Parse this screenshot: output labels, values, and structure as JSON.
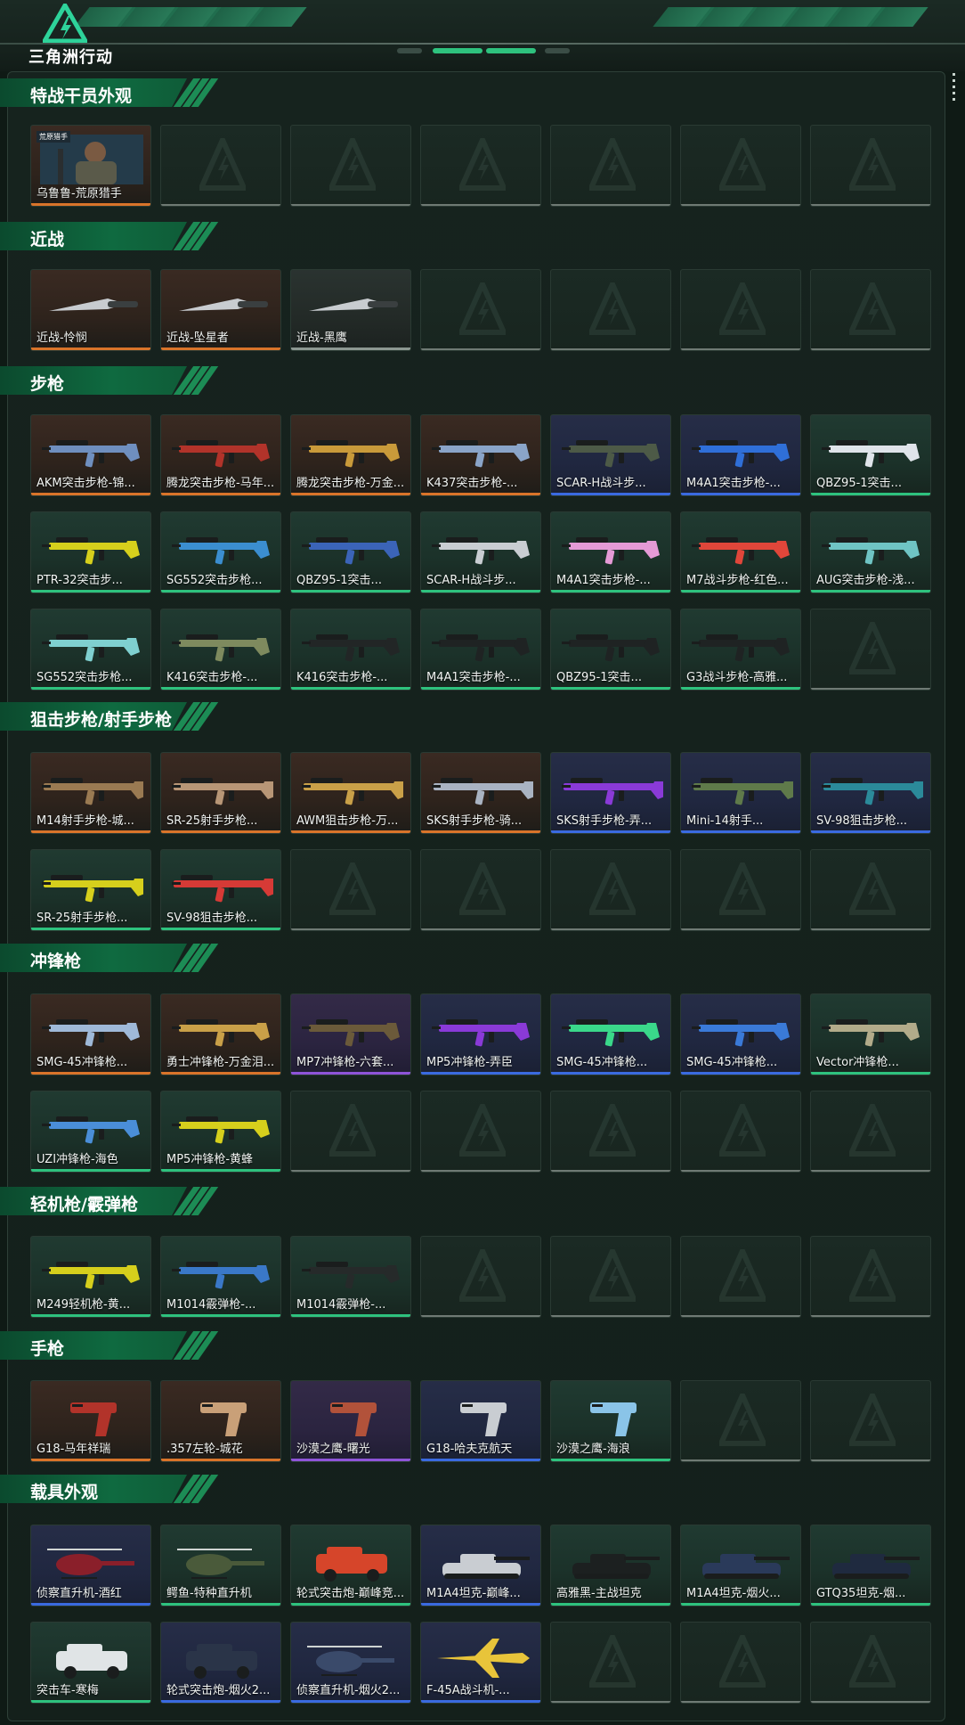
{
  "app": {
    "logo_text": "三角洲行动"
  },
  "colors": {
    "accent": "#2ec27e",
    "rarity_orange": "#d9742a",
    "rarity_blue": "#3a6ae0",
    "rarity_green": "#2ec27e",
    "rarity_purple": "#8e54d8",
    "rarity_gray": "#8c9791"
  },
  "sections": [
    {
      "title": "特战干员外观",
      "rows": [
        [
          {
            "name": "乌鲁鲁-荒原猎手",
            "rarity": "orange",
            "icon": "operator-portrait",
            "badge": "荒原猎手"
          },
          null,
          null,
          null,
          null,
          null,
          null
        ]
      ]
    },
    {
      "title": "近战",
      "rows": [
        [
          {
            "name": "近战-怜悯",
            "rarity": "orange",
            "icon": "knife"
          },
          {
            "name": "近战-坠星者",
            "rarity": "orange",
            "icon": "knife"
          },
          {
            "name": "近战-黑鹰",
            "rarity": "gray",
            "icon": "knife"
          },
          null,
          null,
          null,
          null
        ]
      ]
    },
    {
      "title": "步枪",
      "rows": [
        [
          {
            "name": "AKM突击步枪-锦...",
            "rarity": "orange",
            "icon": "rifle",
            "tint": "#6f8fbf"
          },
          {
            "name": "腾龙突击步枪-马年...",
            "rarity": "orange",
            "icon": "rifle",
            "tint": "#b2332a"
          },
          {
            "name": "腾龙突击步枪-万金...",
            "rarity": "orange",
            "icon": "rifle",
            "tint": "#c99a3a"
          },
          {
            "name": "K437突击步枪-...",
            "rarity": "orange",
            "icon": "rifle",
            "tint": "#8aa4c8"
          },
          {
            "name": "SCAR-H战斗步...",
            "rarity": "blue",
            "icon": "rifle",
            "tint": "#4d5a47"
          },
          {
            "name": "M4A1突击步枪-...",
            "rarity": "blue",
            "icon": "rifle",
            "tint": "#2f6fd8"
          },
          {
            "name": "QBZ95-1突击...",
            "rarity": "green",
            "icon": "rifle",
            "tint": "#dfe4ea"
          }
        ],
        [
          {
            "name": "PTR-32突击步...",
            "rarity": "green",
            "icon": "rifle",
            "tint": "#d6cf1c"
          },
          {
            "name": "SG552突击步枪...",
            "rarity": "green",
            "icon": "rifle",
            "tint": "#3b8ed0"
          },
          {
            "name": "QBZ95-1突击...",
            "rarity": "green",
            "icon": "rifle",
            "tint": "#3b64b8"
          },
          {
            "name": "SCAR-H战斗步...",
            "rarity": "green",
            "icon": "rifle",
            "tint": "#c9cdd2"
          },
          {
            "name": "M4A1突击步枪-...",
            "rarity": "green",
            "icon": "rifle",
            "tint": "#e59ad6"
          },
          {
            "name": "M7战斗步枪-红色...",
            "rarity": "green",
            "icon": "rifle",
            "tint": "#e0463a"
          },
          {
            "name": "AUG突击步枪-浅...",
            "rarity": "green",
            "icon": "rifle",
            "tint": "#6fc4c4"
          }
        ],
        [
          {
            "name": "SG552突击步枪...",
            "rarity": "green",
            "icon": "rifle",
            "tint": "#7fd0d0"
          },
          {
            "name": "K416突击步枪-...",
            "rarity": "green",
            "icon": "rifle",
            "tint": "#7e8a5e"
          },
          {
            "name": "K416突击步枪-...",
            "rarity": "green",
            "icon": "rifle",
            "tint": "#222626"
          },
          {
            "name": "M4A1突击步枪-...",
            "rarity": "green",
            "icon": "rifle",
            "tint": "#1f2323"
          },
          {
            "name": "QBZ95-1突击...",
            "rarity": "green",
            "icon": "rifle",
            "tint": "#1f2323"
          },
          {
            "name": "G3战斗步枪-高雅...",
            "rarity": "green",
            "icon": "rifle",
            "tint": "#1f2323"
          },
          null
        ]
      ]
    },
    {
      "title": "狙击步枪/射手步枪",
      "rows": [
        [
          {
            "name": "M14射手步枪-城...",
            "rarity": "orange",
            "icon": "sniper",
            "tint": "#9a7a52"
          },
          {
            "name": "SR-25射手步枪...",
            "rarity": "orange",
            "icon": "sniper",
            "tint": "#b89676"
          },
          {
            "name": "AWM狙击步枪-万...",
            "rarity": "orange",
            "icon": "sniper",
            "tint": "#c9a048"
          },
          {
            "name": "SKS射手步枪-骑...",
            "rarity": "orange",
            "icon": "sniper",
            "tint": "#a9b3c2"
          },
          {
            "name": "SKS射手步枪-弄...",
            "rarity": "blue",
            "icon": "sniper",
            "tint": "#8a3ad8"
          },
          {
            "name": "Mini-14射手...",
            "rarity": "blue",
            "icon": "sniper",
            "tint": "#5f7a4a"
          },
          {
            "name": "SV-98狙击步枪...",
            "rarity": "blue",
            "icon": "sniper",
            "tint": "#2b8a9a"
          }
        ],
        [
          {
            "name": "SR-25射手步枪...",
            "rarity": "green",
            "icon": "sniper",
            "tint": "#d6cf1c"
          },
          {
            "name": "SV-98狙击步枪...",
            "rarity": "green",
            "icon": "sniper",
            "tint": "#d63a36"
          },
          null,
          null,
          null,
          null,
          null
        ]
      ]
    },
    {
      "title": "冲锋枪",
      "rows": [
        [
          {
            "name": "SMG-45冲锋枪...",
            "rarity": "orange",
            "icon": "smg",
            "tint": "#9fb9d8"
          },
          {
            "name": "勇士冲锋枪-万金泪...",
            "rarity": "orange",
            "icon": "smg",
            "tint": "#c9a048"
          },
          {
            "name": "MP7冲锋枪-六套...",
            "rarity": "purple",
            "icon": "smg",
            "tint": "#6b5a3a"
          },
          {
            "name": "MP5冲锋枪-弄臣",
            "rarity": "blue",
            "icon": "smg",
            "tint": "#8a3ad8"
          },
          {
            "name": "SMG-45冲锋枪...",
            "rarity": "blue",
            "icon": "smg",
            "tint": "#3ad88a"
          },
          {
            "name": "SMG-45冲锋枪...",
            "rarity": "blue",
            "icon": "smg",
            "tint": "#3a7ad8"
          },
          {
            "name": "Vector冲锋枪...",
            "rarity": "green",
            "icon": "smg",
            "tint": "#b2ab8a"
          }
        ],
        [
          {
            "name": "UZI冲锋枪-海色",
            "rarity": "green",
            "icon": "smg",
            "tint": "#4a8ed8"
          },
          {
            "name": "MP5冲锋枪-黄蜂",
            "rarity": "green",
            "icon": "smg",
            "tint": "#d6cf1c"
          },
          null,
          null,
          null,
          null,
          null
        ]
      ]
    },
    {
      "title": "轻机枪/霰弹枪",
      "rows": [
        [
          {
            "name": "M249轻机枪-黄...",
            "rarity": "green",
            "icon": "rifle",
            "tint": "#d6cf1c"
          },
          {
            "name": "M1014霰弹枪-...",
            "rarity": "green",
            "icon": "shotgun",
            "tint": "#3a78c8"
          },
          {
            "name": "M1014霰弹枪-...",
            "rarity": "green",
            "icon": "shotgun",
            "tint": "#262a2a"
          },
          null,
          null,
          null,
          null
        ]
      ]
    },
    {
      "title": "手枪",
      "rows": [
        [
          {
            "name": "G18-马年祥瑞",
            "rarity": "orange",
            "icon": "pistol",
            "tint": "#b2332a"
          },
          {
            "name": ".357左轮-城花",
            "rarity": "orange",
            "icon": "pistol",
            "tint": "#c9a078"
          },
          {
            "name": "沙漠之鹰-曙光",
            "rarity": "purple",
            "icon": "pistol",
            "tint": "#b2523a"
          },
          {
            "name": "G18-哈夫克航天",
            "rarity": "blue",
            "icon": "pistol",
            "tint": "#c9cdd2"
          },
          {
            "name": "沙漠之鹰-海浪",
            "rarity": "green",
            "icon": "pistol",
            "tint": "#8ac4e8"
          },
          null,
          null
        ]
      ]
    },
    {
      "title": "载具外观",
      "rows": [
        [
          {
            "name": "侦察直升机-酒红",
            "rarity": "blue",
            "icon": "helicopter",
            "tint": "#8a1f2a"
          },
          {
            "name": "鳄鱼-特种直升机",
            "rarity": "green",
            "icon": "helicopter",
            "tint": "#4a5a3a"
          },
          {
            "name": "轮式突击炮-巅峰竞...",
            "rarity": "green",
            "icon": "vehicle",
            "tint": "#d6452a"
          },
          {
            "name": "M1A4坦克-巅峰...",
            "rarity": "blue",
            "icon": "tank",
            "tint": "#c9cdd2"
          },
          {
            "name": "高雅黑-主战坦克",
            "rarity": "green",
            "icon": "tank",
            "tint": "#1c2020"
          },
          {
            "name": "M1A4坦克-烟火...",
            "rarity": "green",
            "icon": "tank",
            "tint": "#2a3a5a"
          },
          {
            "name": "GTQ35坦克-烟...",
            "rarity": "green",
            "icon": "tank",
            "tint": "#1f2a3f"
          }
        ],
        [
          {
            "name": "突击车-寒梅",
            "rarity": "green",
            "icon": "vehicle",
            "tint": "#e0e4e6"
          },
          {
            "name": "轮式突击炮-烟火2...",
            "rarity": "blue",
            "icon": "vehicle",
            "tint": "#2a3448"
          },
          {
            "name": "侦察直升机-烟火2...",
            "rarity": "blue",
            "icon": "helicopter",
            "tint": "#3a4a6a"
          },
          {
            "name": "F-45A战斗机-...",
            "rarity": "blue",
            "icon": "jet",
            "tint": "#e8c43a"
          },
          null,
          null,
          null
        ]
      ]
    }
  ]
}
